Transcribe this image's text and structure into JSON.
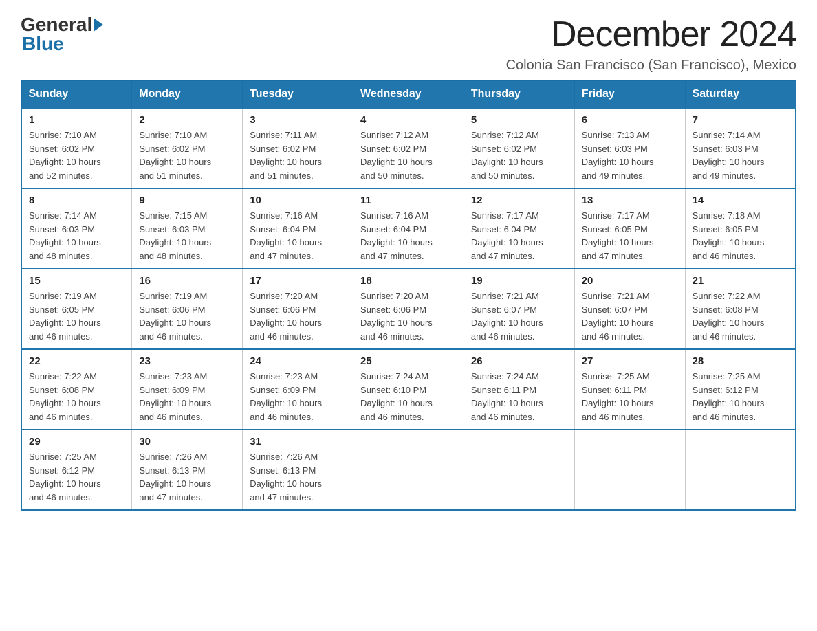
{
  "logo": {
    "general": "General",
    "blue": "Blue"
  },
  "title": "December 2024",
  "subtitle": "Colonia San Francisco (San Francisco), Mexico",
  "days_of_week": [
    "Sunday",
    "Monday",
    "Tuesday",
    "Wednesday",
    "Thursday",
    "Friday",
    "Saturday"
  ],
  "weeks": [
    [
      {
        "day": "1",
        "sunrise": "7:10 AM",
        "sunset": "6:02 PM",
        "daylight": "10 hours and 52 minutes."
      },
      {
        "day": "2",
        "sunrise": "7:10 AM",
        "sunset": "6:02 PM",
        "daylight": "10 hours and 51 minutes."
      },
      {
        "day": "3",
        "sunrise": "7:11 AM",
        "sunset": "6:02 PM",
        "daylight": "10 hours and 51 minutes."
      },
      {
        "day": "4",
        "sunrise": "7:12 AM",
        "sunset": "6:02 PM",
        "daylight": "10 hours and 50 minutes."
      },
      {
        "day": "5",
        "sunrise": "7:12 AM",
        "sunset": "6:02 PM",
        "daylight": "10 hours and 50 minutes."
      },
      {
        "day": "6",
        "sunrise": "7:13 AM",
        "sunset": "6:03 PM",
        "daylight": "10 hours and 49 minutes."
      },
      {
        "day": "7",
        "sunrise": "7:14 AM",
        "sunset": "6:03 PM",
        "daylight": "10 hours and 49 minutes."
      }
    ],
    [
      {
        "day": "8",
        "sunrise": "7:14 AM",
        "sunset": "6:03 PM",
        "daylight": "10 hours and 48 minutes."
      },
      {
        "day": "9",
        "sunrise": "7:15 AM",
        "sunset": "6:03 PM",
        "daylight": "10 hours and 48 minutes."
      },
      {
        "day": "10",
        "sunrise": "7:16 AM",
        "sunset": "6:04 PM",
        "daylight": "10 hours and 47 minutes."
      },
      {
        "day": "11",
        "sunrise": "7:16 AM",
        "sunset": "6:04 PM",
        "daylight": "10 hours and 47 minutes."
      },
      {
        "day": "12",
        "sunrise": "7:17 AM",
        "sunset": "6:04 PM",
        "daylight": "10 hours and 47 minutes."
      },
      {
        "day": "13",
        "sunrise": "7:17 AM",
        "sunset": "6:05 PM",
        "daylight": "10 hours and 47 minutes."
      },
      {
        "day": "14",
        "sunrise": "7:18 AM",
        "sunset": "6:05 PM",
        "daylight": "10 hours and 46 minutes."
      }
    ],
    [
      {
        "day": "15",
        "sunrise": "7:19 AM",
        "sunset": "6:05 PM",
        "daylight": "10 hours and 46 minutes."
      },
      {
        "day": "16",
        "sunrise": "7:19 AM",
        "sunset": "6:06 PM",
        "daylight": "10 hours and 46 minutes."
      },
      {
        "day": "17",
        "sunrise": "7:20 AM",
        "sunset": "6:06 PM",
        "daylight": "10 hours and 46 minutes."
      },
      {
        "day": "18",
        "sunrise": "7:20 AM",
        "sunset": "6:06 PM",
        "daylight": "10 hours and 46 minutes."
      },
      {
        "day": "19",
        "sunrise": "7:21 AM",
        "sunset": "6:07 PM",
        "daylight": "10 hours and 46 minutes."
      },
      {
        "day": "20",
        "sunrise": "7:21 AM",
        "sunset": "6:07 PM",
        "daylight": "10 hours and 46 minutes."
      },
      {
        "day": "21",
        "sunrise": "7:22 AM",
        "sunset": "6:08 PM",
        "daylight": "10 hours and 46 minutes."
      }
    ],
    [
      {
        "day": "22",
        "sunrise": "7:22 AM",
        "sunset": "6:08 PM",
        "daylight": "10 hours and 46 minutes."
      },
      {
        "day": "23",
        "sunrise": "7:23 AM",
        "sunset": "6:09 PM",
        "daylight": "10 hours and 46 minutes."
      },
      {
        "day": "24",
        "sunrise": "7:23 AM",
        "sunset": "6:09 PM",
        "daylight": "10 hours and 46 minutes."
      },
      {
        "day": "25",
        "sunrise": "7:24 AM",
        "sunset": "6:10 PM",
        "daylight": "10 hours and 46 minutes."
      },
      {
        "day": "26",
        "sunrise": "7:24 AM",
        "sunset": "6:11 PM",
        "daylight": "10 hours and 46 minutes."
      },
      {
        "day": "27",
        "sunrise": "7:25 AM",
        "sunset": "6:11 PM",
        "daylight": "10 hours and 46 minutes."
      },
      {
        "day": "28",
        "sunrise": "7:25 AM",
        "sunset": "6:12 PM",
        "daylight": "10 hours and 46 minutes."
      }
    ],
    [
      {
        "day": "29",
        "sunrise": "7:25 AM",
        "sunset": "6:12 PM",
        "daylight": "10 hours and 46 minutes."
      },
      {
        "day": "30",
        "sunrise": "7:26 AM",
        "sunset": "6:13 PM",
        "daylight": "10 hours and 47 minutes."
      },
      {
        "day": "31",
        "sunrise": "7:26 AM",
        "sunset": "6:13 PM",
        "daylight": "10 hours and 47 minutes."
      },
      null,
      null,
      null,
      null
    ]
  ],
  "labels": {
    "sunrise": "Sunrise:",
    "sunset": "Sunset:",
    "daylight": "Daylight:"
  }
}
